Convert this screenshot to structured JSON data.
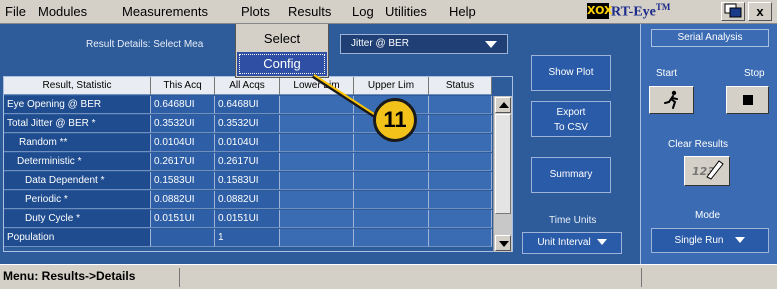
{
  "menubar": {
    "items": [
      "File",
      "Modules",
      "Measurements",
      "Plots",
      "Results",
      "Log",
      "Utilities",
      "Help"
    ],
    "logo_box": "XOX",
    "logo_text": "RT-Eye",
    "logo_sup": "TM",
    "btn_x": "x"
  },
  "dropdown": {
    "items": [
      "Select",
      "Config"
    ],
    "selected": "Config"
  },
  "results": {
    "details_label": "Result Details: Select Mea",
    "selected_measurement": "Jitter @ BER",
    "columns": [
      "Result, Statistic",
      "This Acq",
      "All Acqs",
      "Lower Lim",
      "Upper Lim",
      "Status"
    ],
    "rows": [
      [
        "Eye Opening @ BER",
        "0.6468UI",
        "0.6468UI",
        "",
        "",
        ""
      ],
      [
        "Total Jitter @ BER *",
        "0.3532UI",
        "0.3532UI",
        "",
        "",
        ""
      ],
      [
        "Random **",
        "0.0104UI",
        "0.0104UI",
        "",
        "",
        ""
      ],
      [
        "Deterministic *",
        "0.2617UI",
        "0.2617UI",
        "",
        "",
        ""
      ],
      [
        "Data Dependent *",
        "0.1583UI",
        "0.1583UI",
        "",
        "",
        ""
      ],
      [
        "Periodic *",
        "0.0882UI",
        "0.0882UI",
        "",
        "",
        ""
      ],
      [
        "Duty Cycle *",
        "0.0151UI",
        "0.0151UI",
        "",
        "",
        ""
      ],
      [
        "Population",
        "",
        "1",
        "",
        "",
        ""
      ]
    ]
  },
  "buttons": {
    "show_plot": "Show Plot",
    "export_line1": "Export",
    "export_line2": "To CSV",
    "summary": "Summary",
    "time_units_label": "Time Units",
    "time_units_value": "Unit Interval"
  },
  "serial": {
    "title": "Serial Analysis",
    "start": "Start",
    "stop": "Stop",
    "clear_results": "Clear Results",
    "mode_label": "Mode",
    "mode_value": "Single Run"
  },
  "callout": {
    "number": "11"
  },
  "statusbar": {
    "text": "Menu: Results->Details"
  }
}
